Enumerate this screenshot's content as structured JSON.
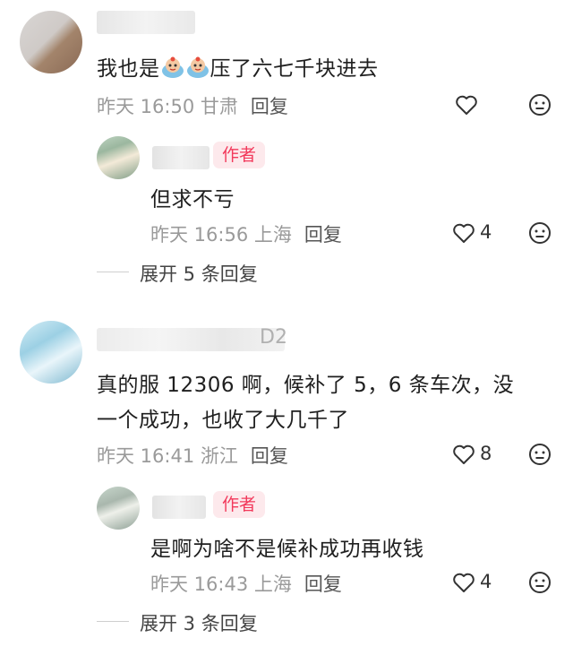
{
  "comments": [
    {
      "text_before": "我也是",
      "emojis": [
        "tearful-cake-emoji",
        "tearful-cake-emoji"
      ],
      "text_after": "压了六七千块进去",
      "meta": "昨天 16:50 甘肃",
      "reply_label": "回复"
    },
    {
      "author_tag": "作者",
      "text": "但求不亏",
      "meta": "昨天 16:56 上海",
      "reply_label": "回复",
      "likes": "4",
      "expand": "展开 5 条回复"
    },
    {
      "name_visible": "D2",
      "text_line1": "真的服 12306 啊，候补了 5，6 条车次，没",
      "text_line2": "一个成功，也收了大几千了",
      "meta": "昨天 16:41 浙江",
      "reply_label": "回复",
      "likes": "8"
    },
    {
      "author_tag": "作者",
      "text": "是啊为啥不是候补成功再收钱",
      "meta": "昨天 16:43 上海",
      "reply_label": "回复",
      "likes": "4",
      "expand": "展开 3 条回复"
    }
  ],
  "colors": {
    "author_tag_bg": "#fde9ec",
    "author_tag_text": "#f2395b",
    "meta_gray": "#9a9a9a"
  },
  "icons": [
    "heart-icon",
    "dislike-face-icon"
  ]
}
